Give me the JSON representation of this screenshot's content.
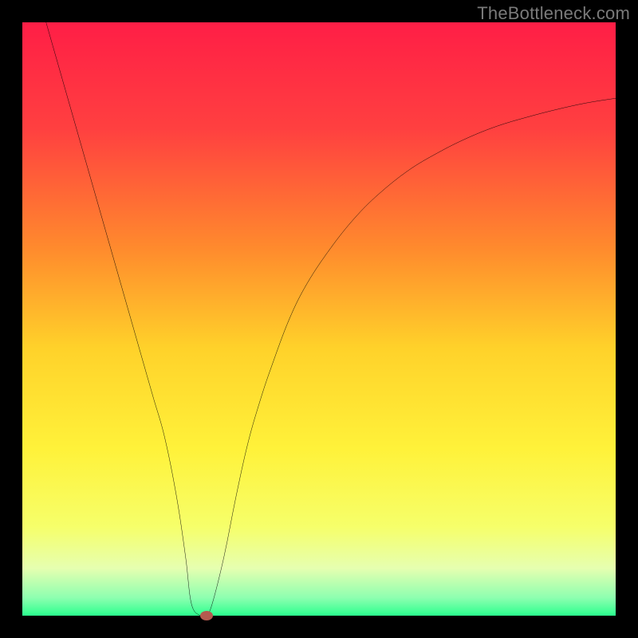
{
  "attribution": "TheBottleneck.com",
  "chart_data": {
    "type": "line",
    "title": "",
    "xlabel": "",
    "ylabel": "",
    "xlim": [
      0,
      100
    ],
    "ylim": [
      0,
      100
    ],
    "grid": false,
    "legend": false,
    "background": {
      "style": "vertical-gradient",
      "stops": [
        {
          "pos": 0.0,
          "color": "#ff1e46"
        },
        {
          "pos": 0.18,
          "color": "#ff4040"
        },
        {
          "pos": 0.38,
          "color": "#ff8a2d"
        },
        {
          "pos": 0.55,
          "color": "#ffd22a"
        },
        {
          "pos": 0.72,
          "color": "#fff23a"
        },
        {
          "pos": 0.85,
          "color": "#f6ff6a"
        },
        {
          "pos": 0.92,
          "color": "#e6ffb0"
        },
        {
          "pos": 0.97,
          "color": "#8dffb0"
        },
        {
          "pos": 1.0,
          "color": "#2bff8e"
        }
      ]
    },
    "series": [
      {
        "name": "bottleneck-curve",
        "x": [
          4,
          6,
          8,
          10,
          12,
          14,
          16,
          18,
          20,
          22,
          24,
          26,
          27.5,
          28.5,
          30,
          31,
          32,
          34,
          36,
          38,
          40,
          42,
          45,
          48,
          52,
          56,
          60,
          65,
          70,
          75,
          80,
          85,
          90,
          95,
          100
        ],
        "values": [
          100,
          93,
          86,
          79,
          72,
          65,
          58,
          51,
          44,
          37,
          30,
          20,
          10,
          2,
          0,
          0,
          2,
          10,
          20,
          29,
          36,
          42,
          50,
          56,
          62,
          67,
          71,
          75,
          78,
          80.5,
          82.5,
          84,
          85.3,
          86.4,
          87.2
        ]
      }
    ],
    "marker": {
      "x": 31,
      "y": 0,
      "color": "#b55a4f"
    }
  }
}
